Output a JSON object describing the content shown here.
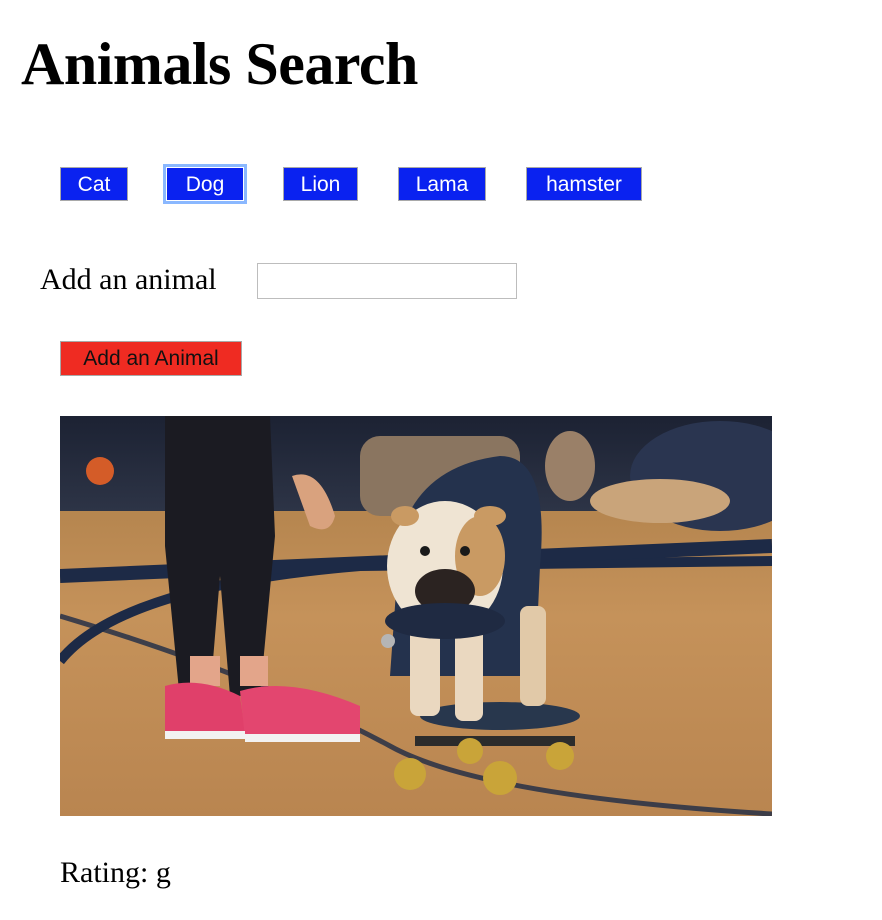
{
  "page": {
    "title": "Animals Search"
  },
  "animal_buttons": [
    {
      "label": "Cat",
      "focused": false
    },
    {
      "label": "Dog",
      "focused": true
    },
    {
      "label": "Lion",
      "focused": false
    },
    {
      "label": "Lama",
      "focused": false
    },
    {
      "label": "hamster",
      "focused": false
    }
  ],
  "add_form": {
    "label": "Add an animal",
    "input_value": "",
    "input_placeholder": "",
    "submit_label": "Add an Animal"
  },
  "results": [
    {
      "image_subject": "bulldog-on-skateboard",
      "rating_label": "Rating:",
      "rating_value": "g"
    }
  ],
  "colors": {
    "animal_button_bg": "#0a22f0",
    "animal_button_text": "#ffffff",
    "add_button_bg": "#ef2b22",
    "focus_ring": "#8ab8ff"
  }
}
